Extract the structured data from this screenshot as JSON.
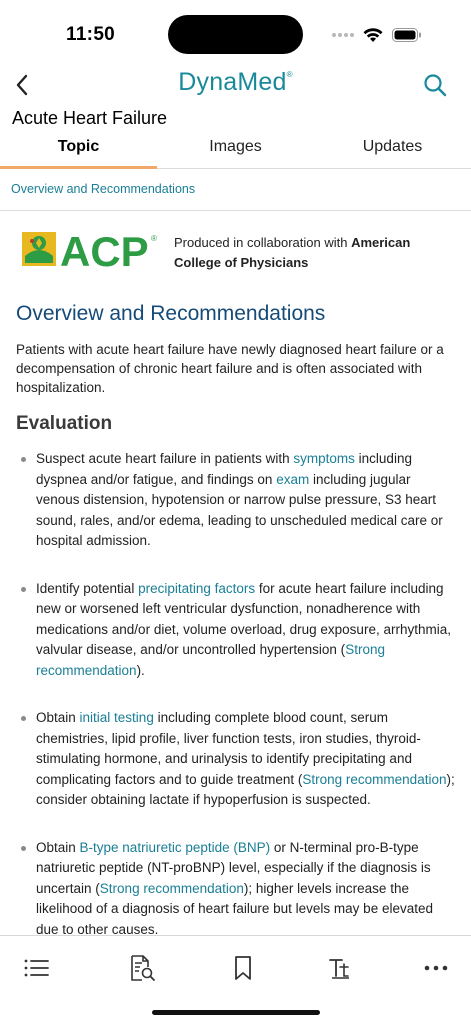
{
  "status_bar": {
    "time": "11:50"
  },
  "nav": {
    "brand": "DynaMed",
    "brand_mark": "®"
  },
  "page_title": "Acute Heart Failure",
  "tabs": [
    {
      "label": "Topic",
      "active": true
    },
    {
      "label": "Images",
      "active": false
    },
    {
      "label": "Updates",
      "active": false
    }
  ],
  "section_link": "Overview and Recommendations",
  "acp": {
    "logo_text": "ACP",
    "produced_prefix": "Produced in collaboration with ",
    "org_name": "American College of Physicians"
  },
  "overview": {
    "heading": "Overview and Recommendations",
    "intro": "Patients with acute heart failure have newly diagnosed heart failure or a decompensation of chronic heart failure and is often associated with hospitalization."
  },
  "evaluation": {
    "heading": "Evaluation",
    "bullets": [
      {
        "t1": "Suspect acute heart failure in patients with ",
        "l1": "symptoms",
        "t2": " including dyspnea and/or fatigue, and findings on ",
        "l2": "exam",
        "t3": " including jugular venous distension, hypotension or narrow pulse pressure, S3 heart sound, rales, and/or edema, leading to unscheduled medical care or hospital admission."
      },
      {
        "t1": "Identify potential ",
        "l1": "precipitating factors",
        "t2": " for acute heart failure including new or worsened left ventricular dysfunction, nonadherence with medications and/or diet, volume overload, drug exposure, arrhythmia, valvular disease, and/or uncontrolled hypertension (",
        "l2": "Strong recommendation",
        "t3": ")."
      },
      {
        "t1": "Obtain ",
        "l1": "initial testing",
        "t2": " including complete blood count, serum chemistries, lipid profile, liver function tests, iron studies, thyroid-stimulating hormone, and urinalysis to identify precipitating and complicating factors and to guide treatment (",
        "l2": "Strong recommendation",
        "t3": "); consider obtaining lactate if hypoperfusion is suspected."
      },
      {
        "t1": "Obtain ",
        "l1": "B-type natriuretic peptide (BNP)",
        "t2": " or N-terminal pro-B-type natriuretic peptide (NT-proBNP) level, especially if the diagnosis is uncertain (",
        "l2": "Strong recommendation",
        "t3": "); higher levels increase the likelihood of a diagnosis of heart failure but levels may be elevated due to other causes."
      }
    ]
  },
  "colors": {
    "brand": "#1a8a9a",
    "link": "#1a7f96",
    "heading": "#144b78",
    "tab_underline": "#f0a868",
    "acp_green": "#2e9b45",
    "acp_yellow": "#e8b820"
  },
  "toolbar": {
    "icons": [
      "list-icon",
      "document-search-icon",
      "bookmark-icon",
      "text-size-icon",
      "more-icon"
    ]
  }
}
